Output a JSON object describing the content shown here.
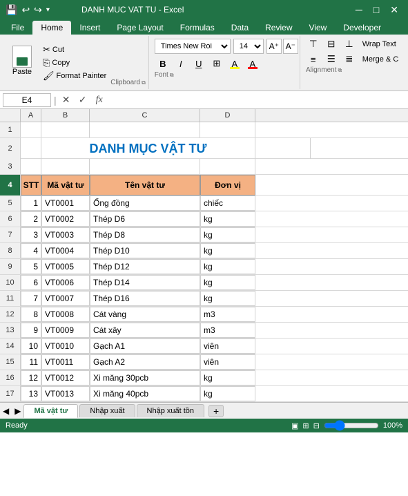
{
  "titlebar": {
    "title": "DANH MUC VAT TU - Excel",
    "save_icon": "💾",
    "undo_icon": "↩",
    "redo_icon": "↪"
  },
  "ribbon": {
    "tabs": [
      "File",
      "Home",
      "Insert",
      "Page Layout",
      "Formulas",
      "Data",
      "Review",
      "View",
      "Developer"
    ],
    "active_tab": "Home",
    "clipboard": {
      "label": "Clipboard",
      "paste_label": "Paste",
      "cut_label": "Cut",
      "copy_label": "Copy",
      "format_painter_label": "Format Painter"
    },
    "font": {
      "label": "Font",
      "name": "Times New Roi",
      "size": "14",
      "bold": "B",
      "italic": "I",
      "underline": "U"
    },
    "alignment": {
      "label": "Alignment",
      "wrap_text": "Wrap Text",
      "merge": "Merge & C"
    }
  },
  "formulabar": {
    "cell_ref": "E4",
    "formula_value": ""
  },
  "columns": {
    "headers": [
      "A",
      "B",
      "C",
      "D"
    ],
    "A_label": "A",
    "B_label": "B",
    "C_label": "C",
    "D_label": "D"
  },
  "title_text": "DANH MỤC VẬT TƯ",
  "table_headers": {
    "stt": "STT",
    "ma_vat_tu": "Mã vật tư",
    "ten_vat_tu": "Tên vật tư",
    "don_vi": "Đơn vị"
  },
  "rows": [
    {
      "stt": "1",
      "ma": "VT0001",
      "ten": "Ống đồng",
      "don_vi": "chiếc"
    },
    {
      "stt": "2",
      "ma": "VT0002",
      "ten": "Thép D6",
      "don_vi": "kg"
    },
    {
      "stt": "3",
      "ma": "VT0003",
      "ten": "Thép D8",
      "don_vi": "kg"
    },
    {
      "stt": "4",
      "ma": "VT0004",
      "ten": "Thép D10",
      "don_vi": "kg"
    },
    {
      "stt": "5",
      "ma": "VT0005",
      "ten": "Thép D12",
      "don_vi": "kg"
    },
    {
      "stt": "6",
      "ma": "VT0006",
      "ten": "Thép D14",
      "don_vi": "kg"
    },
    {
      "stt": "7",
      "ma": "VT0007",
      "ten": "Thép D16",
      "don_vi": "kg"
    },
    {
      "stt": "8",
      "ma": "VT0008",
      "ten": "Cát vàng",
      "don_vi": "m3"
    },
    {
      "stt": "9",
      "ma": "VT0009",
      "ten": "Cát xây",
      "don_vi": "m3"
    },
    {
      "stt": "10",
      "ma": "VT0010",
      "ten": "Gạch A1",
      "don_vi": "viên"
    },
    {
      "stt": "11",
      "ma": "VT0011",
      "ten": "Gạch A2",
      "don_vi": "viên"
    },
    {
      "stt": "12",
      "ma": "VT0012",
      "ten": "Xi măng 30pcb",
      "don_vi": "kg"
    },
    {
      "stt": "13",
      "ma": "VT0013",
      "ten": "Xi măng 40pcb",
      "don_vi": "kg"
    }
  ],
  "row_numbers": [
    "1",
    "2",
    "3",
    "4",
    "5",
    "6",
    "7",
    "8",
    "9",
    "10",
    "11",
    "12",
    "13",
    "14",
    "15",
    "16",
    "17"
  ],
  "sheet_tabs": [
    "Mã vật tư",
    "Nhập xuất",
    "Nhập xuất tồn"
  ],
  "active_sheet": "Mã vật tư",
  "status": "Ready"
}
